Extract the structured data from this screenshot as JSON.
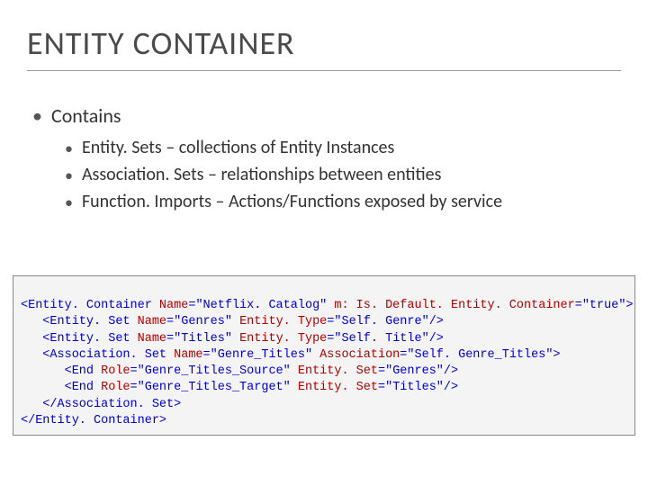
{
  "title": "ENTITY CONTAINER",
  "bullets": {
    "main": "Contains",
    "sub": [
      "Entity. Sets – collections of Entity Instances",
      "Association. Sets – relationships between entities",
      "Function. Imports – Actions/Functions exposed by service"
    ]
  },
  "code": {
    "l1": {
      "a": "<Entity. Container",
      "b": " Name",
      "c": "=\"Netflix. Catalog\" ",
      "d": "m: Is. Default. Entity. Container",
      "e": "=\"true\">"
    },
    "l2": {
      "a": "   <Entity. Set",
      "b": " Name",
      "c": "=\"Genres\" ",
      "d": "Entity. Type",
      "e": "=\"Self. Genre\"/>"
    },
    "l3": {
      "a": "   <Entity. Set",
      "b": " Name",
      "c": "=\"Titles\" ",
      "d": "Entity. Type",
      "e": "=\"Self. Title\"/>"
    },
    "l4": {
      "a": "   <Association. Set",
      "b": " Name",
      "c": "=\"Genre_Titles\" ",
      "d": "Association",
      "e": "=\"Self. Genre_Titles\">"
    },
    "l5": {
      "a": "      <End",
      "b": " Role",
      "c": "=\"Genre_Titles_Source\" ",
      "d": "Entity. Set",
      "e": "=\"Genres\"/>"
    },
    "l6": {
      "a": "      <End",
      "b": " Role",
      "c": "=\"Genre_Titles_Target\" ",
      "d": "Entity. Set",
      "e": "=\"Titles\"/>"
    },
    "l7": "   </Association. Set>",
    "l8": "</Entity. Container>"
  }
}
